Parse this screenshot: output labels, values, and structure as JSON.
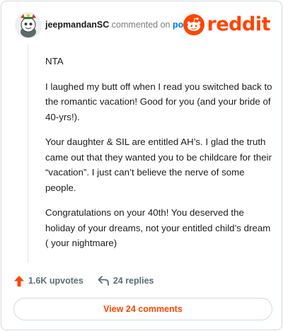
{
  "comment": {
    "username": "jeepmandanSC",
    "commented_on": "commented on",
    "post_link": "post",
    "paragraphs": [
      "NTA",
      "I laughed my butt off when I read you switched back to the romantic vacation! Good for you (and your bride of 40-yrs!).",
      "Your daughter & SIL are entitled AH’s. I glad the truth came out that they wanted you to be childcare for their “vacation”. I just can’t believe the nerve of some people.",
      "Congratulations on your 40th! You deserved the holiday of your dreams, not your entitled child’s dream ( your nightmare)"
    ]
  },
  "brand": {
    "logo_text": "reddit",
    "color": "#ff4500"
  },
  "actions": {
    "upvotes": "1.6K upvotes",
    "replies": "24 replies",
    "upvote_icon": "upvote-arrow-icon",
    "reply_icon": "reply-arrow-icon"
  },
  "footer": {
    "view_comments": "View 24 comments"
  },
  "colors": {
    "accent": "#ff4500",
    "link": "#0079d3",
    "muted": "#576f76"
  }
}
